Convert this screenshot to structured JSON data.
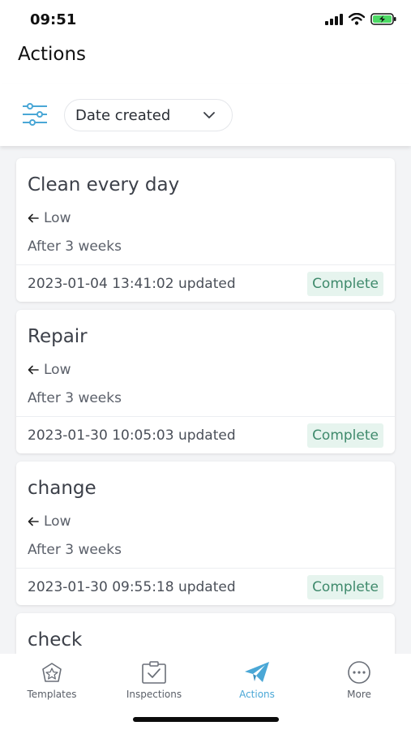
{
  "status_bar": {
    "time": "09:51",
    "icons": [
      "signal-icon",
      "wifi-icon",
      "battery-charging-icon"
    ]
  },
  "header": {
    "title": "Actions"
  },
  "filter_bar": {
    "filter_icon": "sliders-icon",
    "sort_label": "Date created",
    "sort_icon": "chevron-down-icon"
  },
  "actions": [
    {
      "title": "Clean every day",
      "priority": "Low",
      "due": "After 3 weeks",
      "updated": "2023-01-04 13:41:02 updated",
      "status": "Complete"
    },
    {
      "title": "Repair",
      "priority": "Low",
      "due": "After 3 weeks",
      "updated": "2023-01-30 10:05:03 updated",
      "status": "Complete"
    },
    {
      "title": "change",
      "priority": "Low",
      "due": "After 3 weeks",
      "updated": "2023-01-30 09:55:18 updated",
      "status": "Complete"
    },
    {
      "title": "check"
    }
  ],
  "tabs": [
    {
      "label": "Templates",
      "icon": "templates-icon",
      "active": false
    },
    {
      "label": "Inspections",
      "icon": "inspections-icon",
      "active": false
    },
    {
      "label": "Actions",
      "icon": "paper-plane-icon",
      "active": true
    },
    {
      "label": "More",
      "icon": "more-icon",
      "active": false
    }
  ],
  "colors": {
    "accent": "#4aa7d6",
    "complete_badge_bg": "#e6f4ee",
    "complete_badge_text": "#3f8a6c",
    "list_background": "#f3f4f6"
  }
}
